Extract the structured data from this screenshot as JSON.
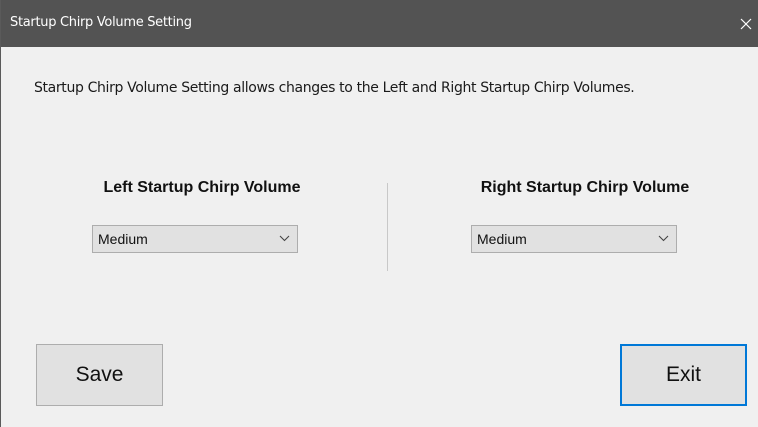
{
  "window": {
    "title": "Startup Chirp Volume Setting"
  },
  "description": "Startup Chirp Volume Setting allows changes to the Left and Right Startup Chirp Volumes.",
  "left_group": {
    "label": "Left Startup Chirp Volume",
    "selected_value": "Medium"
  },
  "right_group": {
    "label": "Right Startup Chirp Volume",
    "selected_value": "Medium"
  },
  "buttons": {
    "save_label": "Save",
    "exit_label": "Exit"
  },
  "icons": {
    "close": "close-icon",
    "dropdown": "chevron-down-icon"
  },
  "colors": {
    "titlebar": "#535353",
    "background": "#f0f0f0",
    "focus_border": "#0078d7"
  }
}
